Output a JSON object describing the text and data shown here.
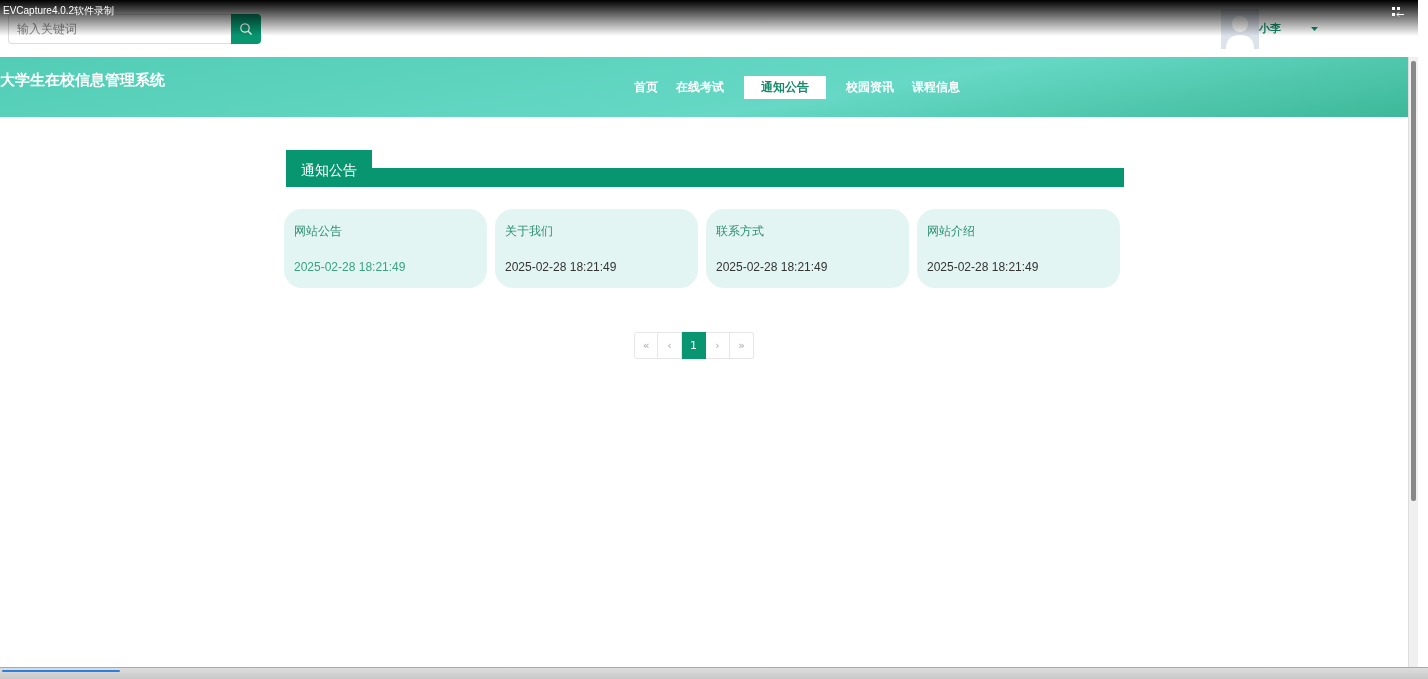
{
  "recorder": {
    "title": "EVCapture4.0.2软件录制",
    "progress": {
      "level": 0.083
    }
  },
  "header": {
    "search": {
      "placeholder": "输入关键词"
    },
    "user": {
      "name": "小李"
    }
  },
  "navbar": {
    "title": "大学生在校信息管理系统",
    "items": [
      {
        "label": "首页",
        "selected": false
      },
      {
        "label": "在线考试",
        "selected": false
      },
      {
        "label": "通知公告",
        "selected": true
      },
      {
        "label": "校园资讯",
        "selected": false
      },
      {
        "label": "课程信息",
        "selected": false
      }
    ]
  },
  "section": {
    "title": "通知公告",
    "cards": [
      {
        "title": "网站公告",
        "date": "2025-02-28 18:21:49",
        "hovered": true
      },
      {
        "title": "关于我们",
        "date": "2025-02-28 18:21:49",
        "hovered": false
      },
      {
        "title": "联系方式",
        "date": "2025-02-28 18:21:49",
        "hovered": false
      },
      {
        "title": "网站介绍",
        "date": "2025-02-28 18:21:49",
        "hovered": false
      }
    ]
  },
  "pagination": [
    {
      "label": "«",
      "selected": false
    },
    {
      "label": "‹",
      "selected": false
    },
    {
      "label": "1",
      "selected": true
    },
    {
      "label": "›",
      "selected": false
    },
    {
      "label": "»",
      "selected": false
    }
  ]
}
